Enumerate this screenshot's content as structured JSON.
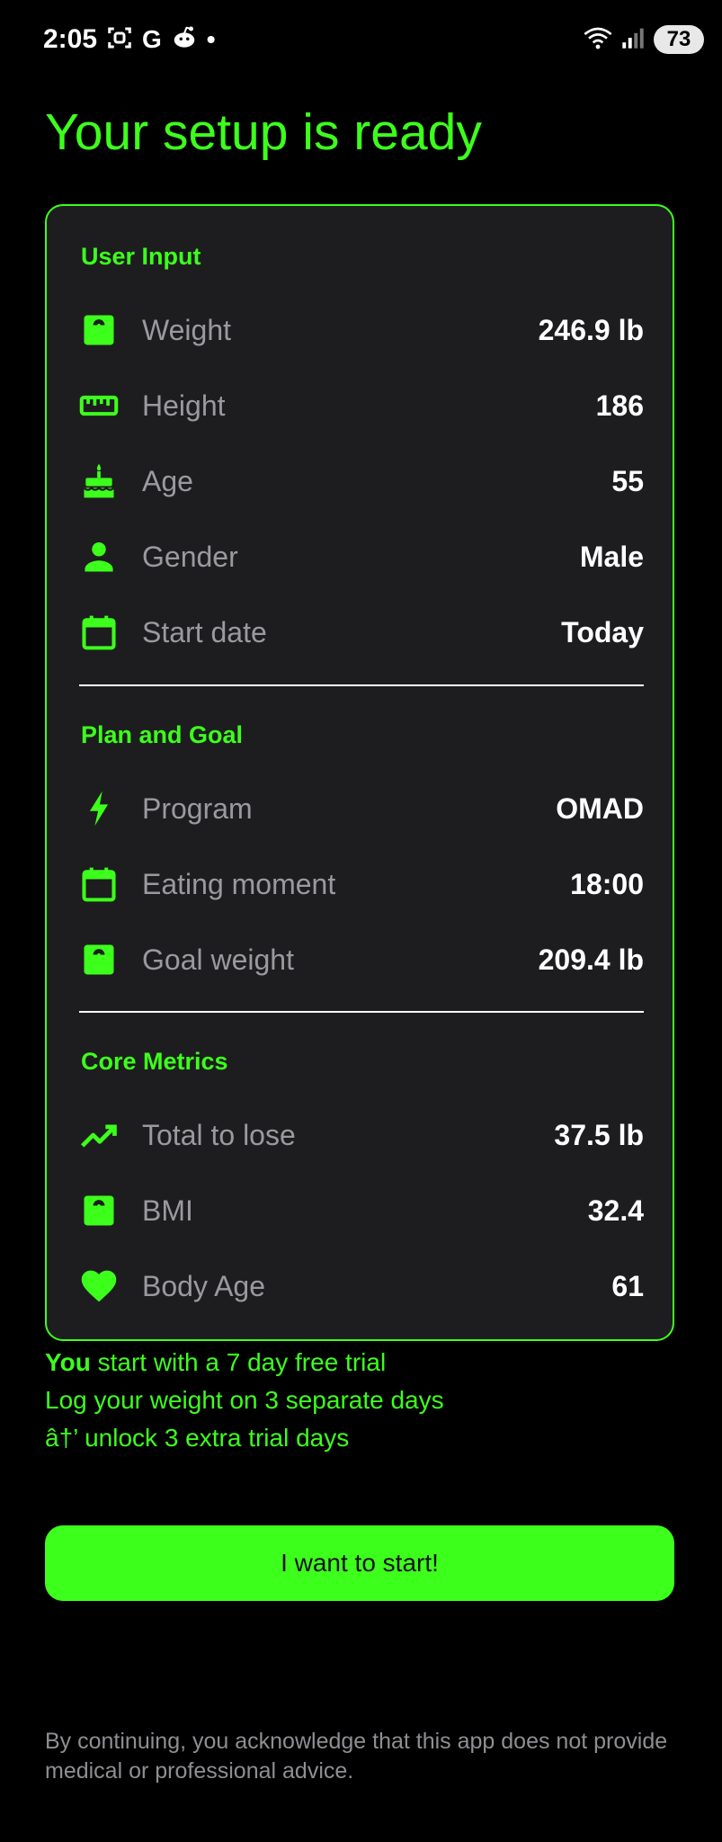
{
  "status_bar": {
    "time": "2:05",
    "battery": "73",
    "icons": [
      "screenshot-icon",
      "google-icon",
      "reddit-icon",
      "dot-icon",
      "wifi-icon",
      "signal-icon",
      "battery-icon"
    ],
    "google_glyph": "G",
    "dot_glyph": "•"
  },
  "page": {
    "title": "Your setup is ready"
  },
  "colors": {
    "accent": "#3dff1c",
    "card_background": "#1d1d1f",
    "label": "#9a9a9e",
    "value": "#ffffff",
    "background": "#000000"
  },
  "sections": {
    "user_input": {
      "title": "User Input",
      "rows": [
        {
          "label": "Weight",
          "value": "246.9 lb",
          "icon": "scale-icon"
        },
        {
          "label": "Height",
          "value": "186",
          "icon": "ruler-icon"
        },
        {
          "label": "Age",
          "value": "55",
          "icon": "cake-icon"
        },
        {
          "label": "Gender",
          "value": "Male",
          "icon": "person-icon"
        },
        {
          "label": "Start date",
          "value": "Today",
          "icon": "calendar-icon"
        }
      ]
    },
    "plan_goal": {
      "title": "Plan and Goal",
      "rows": [
        {
          "label": "Program",
          "value": "OMAD",
          "icon": "bolt-icon"
        },
        {
          "label": "Eating moment",
          "value": "18:00",
          "icon": "calendar-icon"
        },
        {
          "label": "Goal weight",
          "value": "209.4 lb",
          "icon": "scale-icon"
        }
      ]
    },
    "core_metrics": {
      "title": "Core Metrics",
      "rows": [
        {
          "label": "Total to lose",
          "value": "37.5 lb",
          "icon": "trend-icon"
        },
        {
          "label": "BMI",
          "value": "32.4",
          "icon": "scale-icon"
        },
        {
          "label": "Body Age",
          "value": "61",
          "icon": "heart-icon"
        }
      ]
    }
  },
  "trial": {
    "line1_strong": "You",
    "line1_rest": " start with a 7 day free trial",
    "line2": "Log your weight on 3 separate days",
    "line3": "â†’ unlock 3 extra trial days"
  },
  "cta": {
    "label": "I want to start!"
  },
  "disclaimer": "By continuing, you acknowledge that this app does not provide medical or professional advice."
}
